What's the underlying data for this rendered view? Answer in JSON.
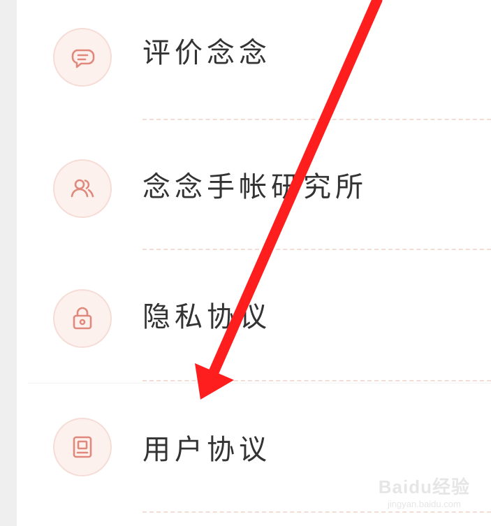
{
  "menu": {
    "items": [
      {
        "label": "评价念念",
        "icon": "chat-bubble-icon"
      },
      {
        "label": "念念手帐研究所",
        "icon": "users-icon"
      },
      {
        "label": "隐私协议",
        "icon": "lock-icon"
      },
      {
        "label": "用户协议",
        "icon": "document-icon"
      }
    ]
  },
  "watermark": {
    "brand": "Baidu经验",
    "url": "jingyan.baidu.com"
  },
  "colors": {
    "icon_stroke": "#e0887b",
    "icon_bg": "#fdf1ee",
    "dash": "#f2ddd6",
    "arrow": "#ff1e1e"
  }
}
